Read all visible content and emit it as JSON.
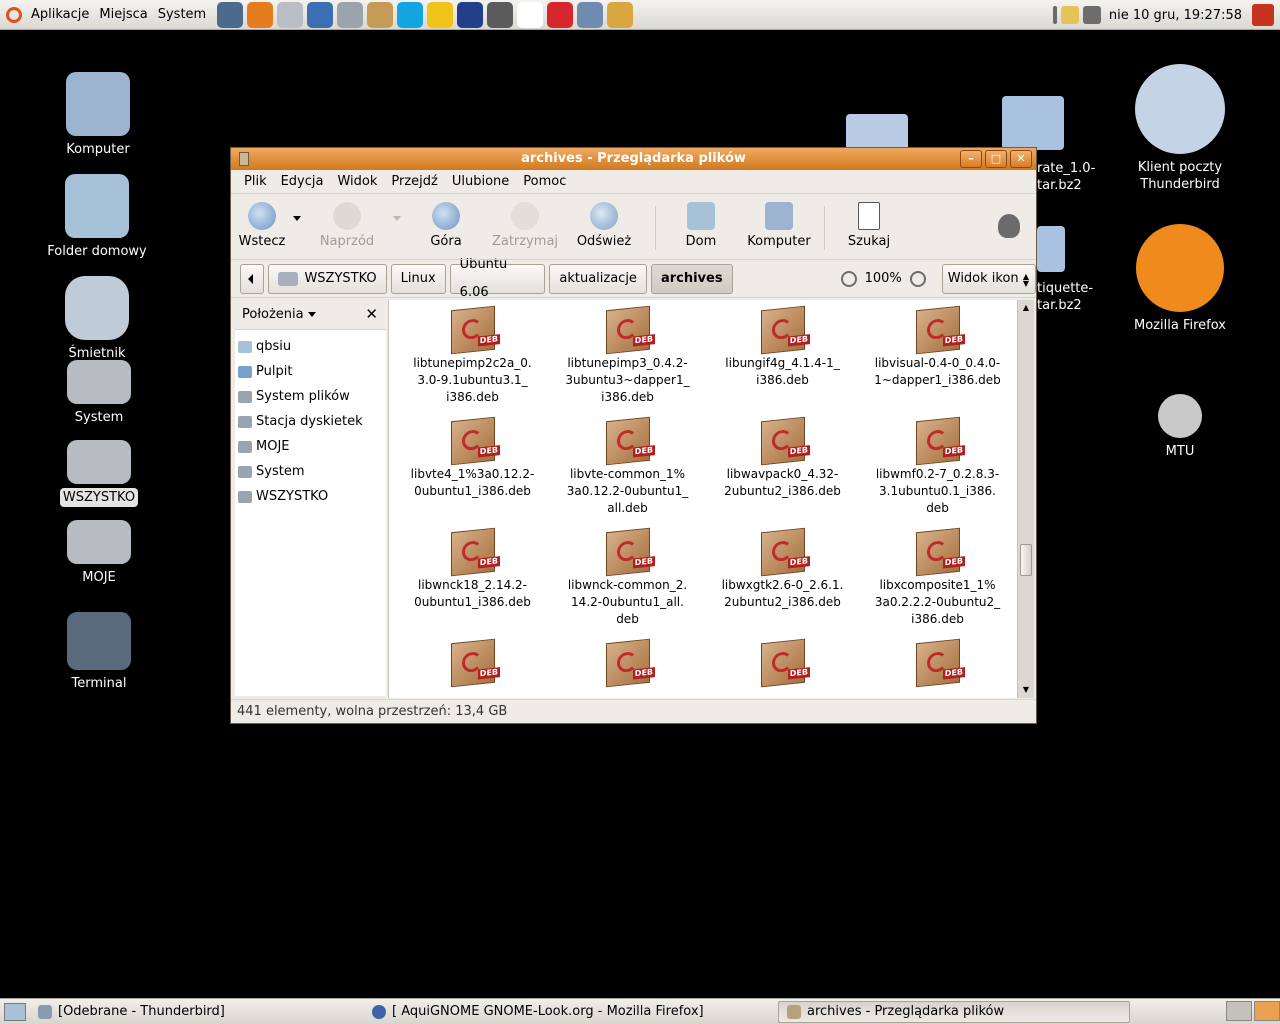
{
  "top_panel": {
    "menus": [
      "Aplikacje",
      "Miejsca",
      "System"
    ],
    "launchers": [
      {
        "name": "monitor-launcher-icon",
        "color": "#4c6a8e"
      },
      {
        "name": "firefox-launcher-icon",
        "color": "#e57d1f"
      },
      {
        "name": "clock-launcher-icon",
        "color": "#b9bec6"
      },
      {
        "name": "file-launcher-icon",
        "color": "#3c6eb4"
      },
      {
        "name": "drive-launcher-icon",
        "color": "#9ba3ad"
      },
      {
        "name": "gimp-launcher-icon",
        "color": "#c49a57"
      },
      {
        "name": "skype-launcher-icon",
        "color": "#12a5e0"
      },
      {
        "name": "sun-launcher-icon",
        "color": "#f0c419"
      },
      {
        "name": "tux-launcher-icon",
        "color": "#243f8a"
      },
      {
        "name": "home-launcher-icon",
        "color": "#5b5b5b"
      },
      {
        "name": "mplayer-launcher-icon",
        "color": "#ffffff"
      },
      {
        "name": "ib-launcher-icon",
        "color": "#d7262e"
      },
      {
        "name": "bird-launcher-icon",
        "color": "#6f8bb0"
      },
      {
        "name": "cd-launcher-icon",
        "color": "#d9a640"
      }
    ],
    "clock": "nie 10 gru, 19:27:58"
  },
  "desktop_icons": [
    {
      "label": "Komputer",
      "color": "#9db4d0"
    },
    {
      "label": "Folder domowy",
      "color": "#a7c1d9"
    },
    {
      "label": "Śmietnik",
      "color": "#bfcbd6"
    },
    {
      "label": "System",
      "color": "#b7bcc3"
    },
    {
      "label": "WSZYSTKO",
      "color": "#b7bcc3"
    },
    {
      "label": "MOJE",
      "color": "#b7bcc3"
    },
    {
      "label": "Terminal",
      "color": "#5a6a7d"
    }
  ],
  "desktop_icons_right": [
    {
      "label": "Klient poczty Thunderbird",
      "color": "#c5d3e6"
    },
    {
      "label": "Mozilla Firefox",
      "color": "#ef8a1d"
    },
    {
      "label": "MTU",
      "color": "#c9c9c9"
    }
  ],
  "desktop_partial": {
    "file1": "rate_1.0-\ntar.bz2",
    "file2": "tiquette-\ntar.bz2"
  },
  "window": {
    "title": "archives - Przeglądarka plików",
    "menu": [
      "Plik",
      "Edycja",
      "Widok",
      "Przejdź",
      "Ulubione",
      "Pomoc"
    ],
    "toolbar": {
      "back": "Wstecz",
      "forward": "Naprzód",
      "up": "Góra",
      "stop": "Zatrzymaj",
      "reload": "Odśwież",
      "home": "Dom",
      "computer": "Komputer",
      "search": "Szukaj"
    },
    "path": [
      "WSZYSTKO",
      "Linux",
      "Ubuntu 6.06",
      "aktualizacje",
      "archives"
    ],
    "zoom": "100%",
    "view_mode": "Widok ikon",
    "side_pane": {
      "title": "Położenia",
      "places": [
        "qbsiu",
        "Pulpit",
        "System plików",
        "Stacja dyskietek",
        "MOJE",
        "System",
        "WSZYSTKO"
      ]
    },
    "files": [
      "libtunepimp2c2a_0.\n3.0-9.1ubuntu3.1_\ni386.deb",
      "libtunepimp3_0.4.2-\n3ubuntu3~dapper1_\ni386.deb",
      "libungif4g_4.1.4-1_\ni386.deb",
      "libvisual-0.4-0_0.4.0-\n1~dapper1_i386.deb",
      "libvte4_1%3a0.12.2-\n0ubuntu1_i386.deb",
      "libvte-common_1%\n3a0.12.2-0ubuntu1_\nall.deb",
      "libwavpack0_4.32-\n2ubuntu2_i386.deb",
      "libwmf0.2-7_0.2.8.3-\n3.1ubuntu0.1_i386.\ndeb",
      "libwnck18_2.14.2-\n0ubuntu1_i386.deb",
      "libwnck-common_2.\n14.2-0ubuntu1_all.\ndeb",
      "libwxgtk2.6-0_2.6.1.\n2ubuntu2_i386.deb",
      "libxcomposite1_1%\n3a0.2.2.2-0ubuntu2_\ni386.deb",
      "",
      "",
      "",
      ""
    ],
    "deb_tag": "DEB",
    "status": "441 elementy, wolna przestrzeń: 13,4 GB"
  },
  "bottom_panel": {
    "tasks": [
      {
        "label": "[Odebrane - Thunderbird]",
        "color": "#8a9bb0"
      },
      {
        "label": "[ AquiGNOME GNOME-Look.org - Mozilla Firefox]",
        "color": "#3e62a8"
      },
      {
        "label": "archives - Przeglądarka plików",
        "color": "#b5a27a"
      }
    ]
  }
}
